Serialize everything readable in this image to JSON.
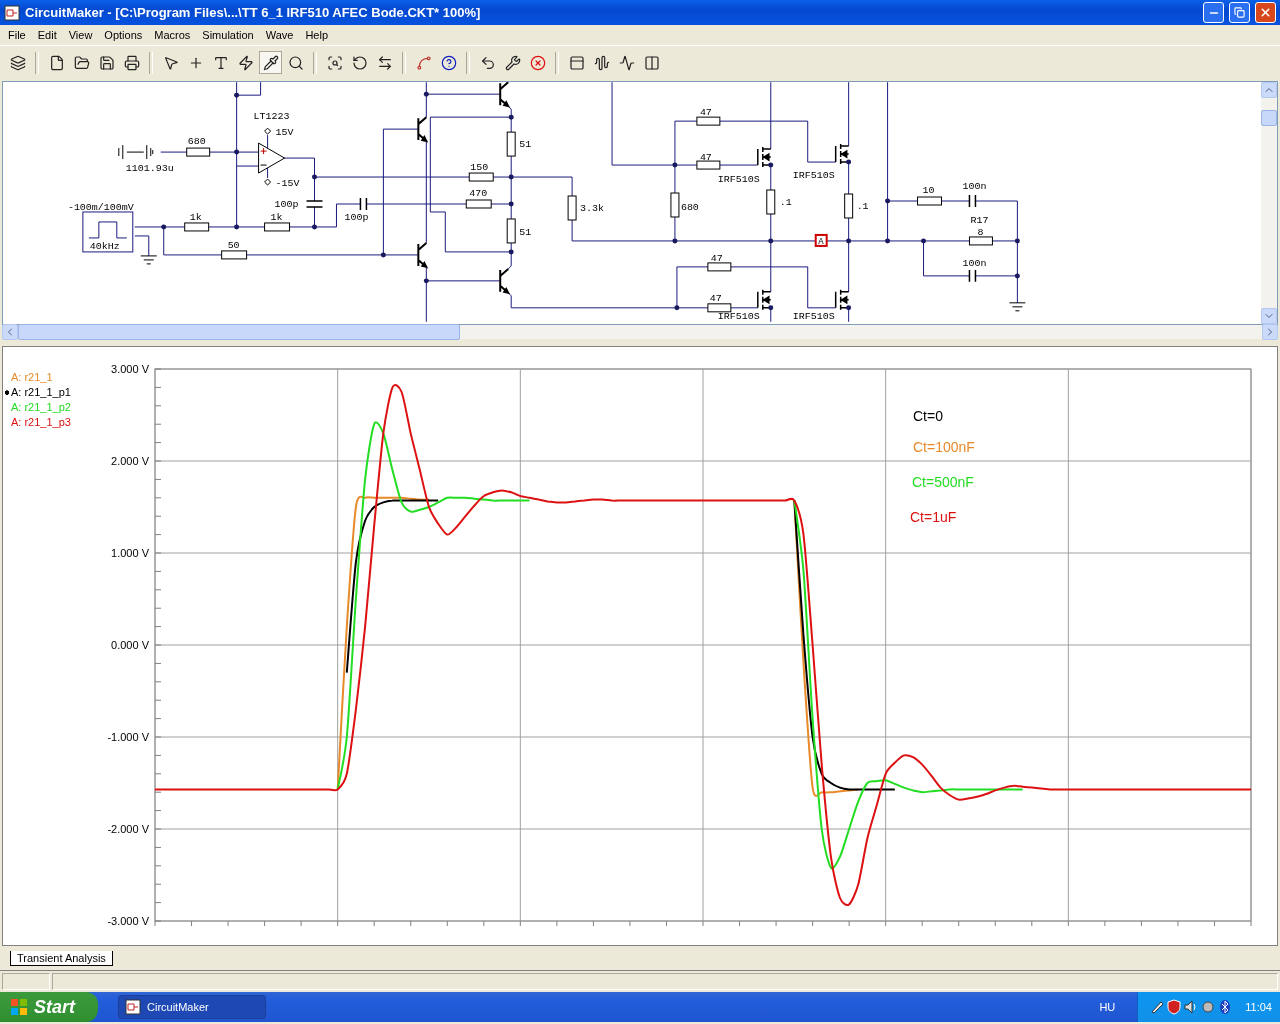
{
  "window": {
    "title": "CircuitMaker - [C:\\Program Files\\...\\TT 6_1 IRF510 AFEC Bode.CKT* 100%]"
  },
  "menu": [
    "File",
    "Edit",
    "View",
    "Options",
    "Macros",
    "Simulation",
    "Wave",
    "Help"
  ],
  "toolbar_buttons": [
    {
      "selected": false
    },
    {
      "selected": false
    },
    {
      "selected": false
    },
    {
      "selected": false
    },
    {
      "selected": false
    },
    {
      "selected": false
    },
    {
      "selected": false
    },
    {
      "selected": false
    },
    {
      "selected": false
    },
    {
      "selected": true
    },
    {
      "selected": false
    },
    {
      "selected": false
    },
    {
      "selected": false
    },
    {
      "selected": false
    },
    {
      "selected": false
    },
    {
      "selected": false
    },
    {
      "selected": false
    },
    {
      "selected": false
    },
    {
      "selected": false
    },
    {
      "selected": false
    },
    {
      "selected": false
    },
    {
      "selected": false
    },
    {
      "selected": false
    }
  ],
  "schematic": {
    "labels": [
      "LT1223",
      "47",
      "15V",
      "680",
      "51",
      "47",
      "1101.93u",
      "150",
      "-15V",
      "IRF510S",
      "IRF510S",
      "470",
      "10",
      "100n",
      "-100m/100mV",
      "100p",
      "3.3k",
      "680",
      ".1",
      ".1",
      "1k",
      "1k",
      "100p",
      "R17",
      "51",
      "8",
      "40kHz",
      "50",
      "47",
      "100n",
      "47",
      "IRF510S",
      "IRF510S"
    ],
    "probe": "A"
  },
  "waveform": {
    "traces": [
      {
        "label": "A: r21_1",
        "color": "#e8892a",
        "selected": false
      },
      {
        "label": "A: r21_1_p1",
        "color": "#000000",
        "selected": true
      },
      {
        "label": "A: r21_1_p2",
        "color": "#22dd22",
        "selected": false
      },
      {
        "label": "A: r21_1_p3",
        "color": "#dd1111",
        "selected": false
      }
    ],
    "chart_data": {
      "type": "line",
      "ylim": [
        -3,
        3
      ],
      "grid": true,
      "yticks": [
        {
          "value": 3,
          "label": "3.000 V"
        },
        {
          "value": 2,
          "label": "2.000 V"
        },
        {
          "value": 1,
          "label": "1.000 V"
        },
        {
          "value": 0,
          "label": "0.000 V"
        },
        {
          "value": -1,
          "label": "-1.000 V"
        },
        {
          "value": -2,
          "label": "-2.000 V"
        },
        {
          "value": -3,
          "label": "-3.000 V"
        }
      ],
      "categories": [
        null,
        null,
        null,
        null,
        null,
        null,
        null,
        null,
        null,
        null,
        null,
        null,
        null,
        null,
        null,
        null,
        null,
        null,
        null,
        null,
        null,
        null,
        null,
        null,
        null,
        null,
        null,
        null,
        null,
        null,
        null,
        null,
        null,
        null,
        null,
        null,
        null,
        null,
        null,
        null,
        null,
        null,
        null,
        null,
        null,
        null,
        null,
        null,
        null,
        null,
        null,
        null,
        null,
        null,
        null,
        null,
        null,
        null,
        null,
        null,
        null,
        null,
        null,
        null,
        null,
        null,
        null,
        null,
        null,
        null,
        null,
        null,
        null,
        null,
        null,
        null,
        null,
        null,
        null,
        null,
        null,
        null,
        null,
        null,
        null,
        null,
        null,
        null,
        null,
        null,
        null,
        null,
        null,
        null,
        null,
        null,
        null,
        null,
        null,
        null,
        null,
        null,
        null,
        null,
        null,
        null,
        null,
        null,
        null,
        null,
        null,
        null,
        null,
        null,
        null,
        null,
        null,
        null,
        null,
        null,
        null
      ],
      "series": [
        {
          "color": "#e8892a",
          "values": [
            null,
            null,
            null,
            null,
            null,
            null,
            null,
            null,
            null,
            null,
            null,
            null,
            null,
            null,
            null,
            null,
            null,
            null,
            null,
            null,
            -1.57,
            0.2,
            1.5,
            1.6,
            1.6,
            1.6,
            1.6,
            1.6,
            1.59,
            1.58,
            1.58,
            null,
            null,
            null,
            null,
            null,
            null,
            null,
            null,
            null,
            null,
            null,
            null,
            null,
            null,
            null,
            null,
            null,
            null,
            null,
            null,
            null,
            null,
            null,
            null,
            null,
            null,
            null,
            null,
            null,
            null,
            null,
            null,
            null,
            null,
            null,
            null,
            null,
            null,
            null,
            1.57,
            -0.2,
            -1.55,
            -1.6,
            -1.6,
            -1.59,
            -1.58,
            -1.57,
            null,
            null,
            null,
            null,
            null,
            null,
            null,
            null,
            null,
            null,
            null,
            null,
            null,
            null,
            null,
            null,
            null,
            null,
            null,
            null,
            null,
            null,
            null,
            null,
            null,
            null,
            null,
            null,
            null,
            null,
            null,
            null,
            null,
            null,
            null,
            null,
            null,
            null,
            null,
            null,
            null,
            null,
            null
          ]
        },
        {
          "color": "#000000",
          "values": [
            null,
            null,
            null,
            null,
            null,
            null,
            null,
            null,
            null,
            null,
            null,
            null,
            null,
            null,
            null,
            null,
            null,
            null,
            null,
            null,
            null,
            -0.3,
            0.9,
            1.35,
            1.5,
            1.55,
            1.57,
            1.57,
            1.57,
            1.57,
            1.57,
            1.57,
            null,
            null,
            null,
            null,
            null,
            null,
            null,
            null,
            null,
            null,
            null,
            null,
            null,
            null,
            null,
            null,
            null,
            null,
            null,
            null,
            null,
            null,
            null,
            null,
            null,
            null,
            null,
            null,
            null,
            null,
            null,
            null,
            null,
            null,
            null,
            null,
            null,
            null,
            1.57,
            0.1,
            -1.0,
            -1.4,
            -1.5,
            -1.55,
            -1.57,
            -1.57,
            -1.57,
            -1.57,
            -1.57,
            -1.57,
            null,
            null,
            null,
            null,
            null,
            null,
            null,
            null,
            null,
            null,
            null,
            null,
            null,
            null,
            null,
            null,
            null,
            null,
            null,
            null,
            null,
            null,
            null,
            null,
            null,
            null,
            null,
            null,
            null,
            null,
            null,
            null,
            null,
            null,
            null,
            null,
            null,
            null,
            null
          ]
        },
        {
          "color": "#22dd22",
          "values": [
            null,
            null,
            null,
            null,
            null,
            null,
            null,
            null,
            null,
            null,
            null,
            null,
            null,
            null,
            null,
            null,
            null,
            null,
            null,
            null,
            -1.57,
            -1.0,
            0.5,
            1.8,
            2.4,
            2.3,
            1.9,
            1.55,
            1.45,
            1.47,
            1.5,
            1.55,
            1.6,
            1.6,
            1.6,
            1.59,
            1.58,
            1.57,
            1.57,
            1.57,
            1.57,
            1.57,
            null,
            null,
            null,
            null,
            null,
            null,
            null,
            null,
            null,
            null,
            null,
            null,
            null,
            null,
            null,
            null,
            null,
            null,
            null,
            null,
            null,
            null,
            null,
            null,
            null,
            null,
            null,
            null,
            1.57,
            0.8,
            -0.8,
            -2.0,
            -2.42,
            -2.3,
            -2.0,
            -1.7,
            -1.5,
            -1.48,
            -1.47,
            -1.51,
            -1.55,
            -1.58,
            -1.6,
            -1.59,
            -1.58,
            -1.57,
            -1.57,
            -1.57,
            -1.57,
            -1.57,
            -1.57,
            -1.57,
            -1.57,
            -1.57,
            null,
            null,
            null,
            null,
            null,
            null,
            null,
            null,
            null,
            null,
            null,
            null,
            null,
            null,
            null,
            null,
            null,
            null,
            null,
            null,
            null,
            null,
            null,
            null,
            null
          ]
        },
        {
          "color": "#dd1111",
          "values": [
            -1.57,
            -1.57,
            -1.57,
            -1.57,
            -1.57,
            -1.57,
            -1.57,
            -1.57,
            -1.57,
            -1.57,
            -1.57,
            -1.57,
            -1.57,
            -1.57,
            -1.57,
            -1.57,
            -1.57,
            -1.57,
            -1.57,
            -1.57,
            -1.57,
            -1.4,
            -0.7,
            0.2,
            1.3,
            2.3,
            2.8,
            2.75,
            2.3,
            1.9,
            1.5,
            1.32,
            1.2,
            1.28,
            1.4,
            1.52,
            1.62,
            1.66,
            1.68,
            1.66,
            1.62,
            1.6,
            1.58,
            1.56,
            1.55,
            1.55,
            1.56,
            1.57,
            1.58,
            1.58,
            1.57,
            1.57,
            1.57,
            1.57,
            1.57,
            1.57,
            1.57,
            1.57,
            1.57,
            1.57,
            1.57,
            1.57,
            1.57,
            1.57,
            1.57,
            1.57,
            1.57,
            1.57,
            1.57,
            1.57,
            1.57,
            1.2,
            0.0,
            -1.3,
            -2.3,
            -2.75,
            -2.82,
            -2.6,
            -2.1,
            -1.75,
            -1.4,
            -1.28,
            -1.2,
            -1.22,
            -1.3,
            -1.42,
            -1.55,
            -1.63,
            -1.68,
            -1.67,
            -1.65,
            -1.62,
            -1.58,
            -1.55,
            -1.53,
            -1.54,
            -1.55,
            -1.56,
            -1.57,
            -1.57,
            -1.57,
            -1.57,
            -1.57,
            -1.57,
            -1.57,
            -1.57,
            -1.57,
            -1.57,
            -1.57,
            -1.57,
            -1.57,
            -1.57,
            -1.57,
            -1.57,
            -1.57,
            -1.57,
            -1.57,
            -1.57,
            -1.57,
            -1.57,
            -1.57
          ]
        }
      ],
      "annotations": [
        {
          "text": "Ct=0"
        },
        {
          "text": "Ct=100nF"
        },
        {
          "text": "Ct=500nF"
        },
        {
          "text": "Ct=1uF"
        }
      ]
    }
  },
  "analysis_tabs": [
    {
      "label": "Transient Analysis",
      "selected": true
    }
  ],
  "taskbar": {
    "start": "Start",
    "tasks": [
      {
        "label": "CircuitMaker",
        "selected": true
      }
    ],
    "language": "HU",
    "clock": "11:04"
  }
}
